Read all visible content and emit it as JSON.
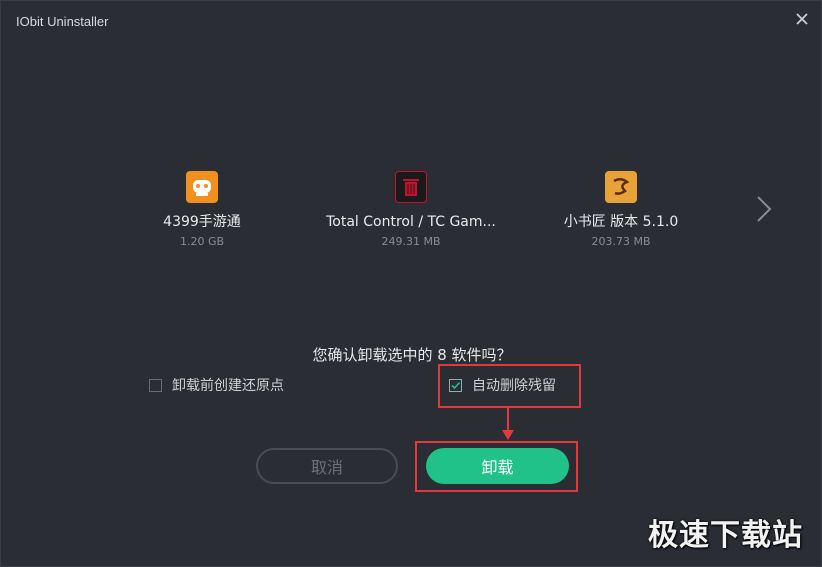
{
  "window": {
    "title": "IObit Uninstaller"
  },
  "apps": [
    {
      "name": "4399手游通",
      "size": "1.20 GB",
      "icon": "4399-app-icon",
      "color": "#f0901e"
    },
    {
      "name": "Total Control / TC Gam...",
      "size": "249.31 MB",
      "icon": "trash-app-icon",
      "color": "#c8102e"
    },
    {
      "name": "小书匠 版本 5.1.0",
      "size": "203.73 MB",
      "icon": "xiaoshujiang-app-icon",
      "color": "#e8a23a"
    }
  ],
  "question": "您确认卸载选中的 8 软件吗？",
  "options": {
    "restore_point": {
      "label": "卸载前创建还原点",
      "checked": false
    },
    "auto_delete": {
      "label": "自动删除残留",
      "checked": true
    }
  },
  "buttons": {
    "cancel": "取消",
    "uninstall": "卸载"
  },
  "watermark": "极速下载站",
  "colors": {
    "accent": "#21c28a",
    "highlight": "#e23a3a",
    "background": "#2b2d35"
  }
}
